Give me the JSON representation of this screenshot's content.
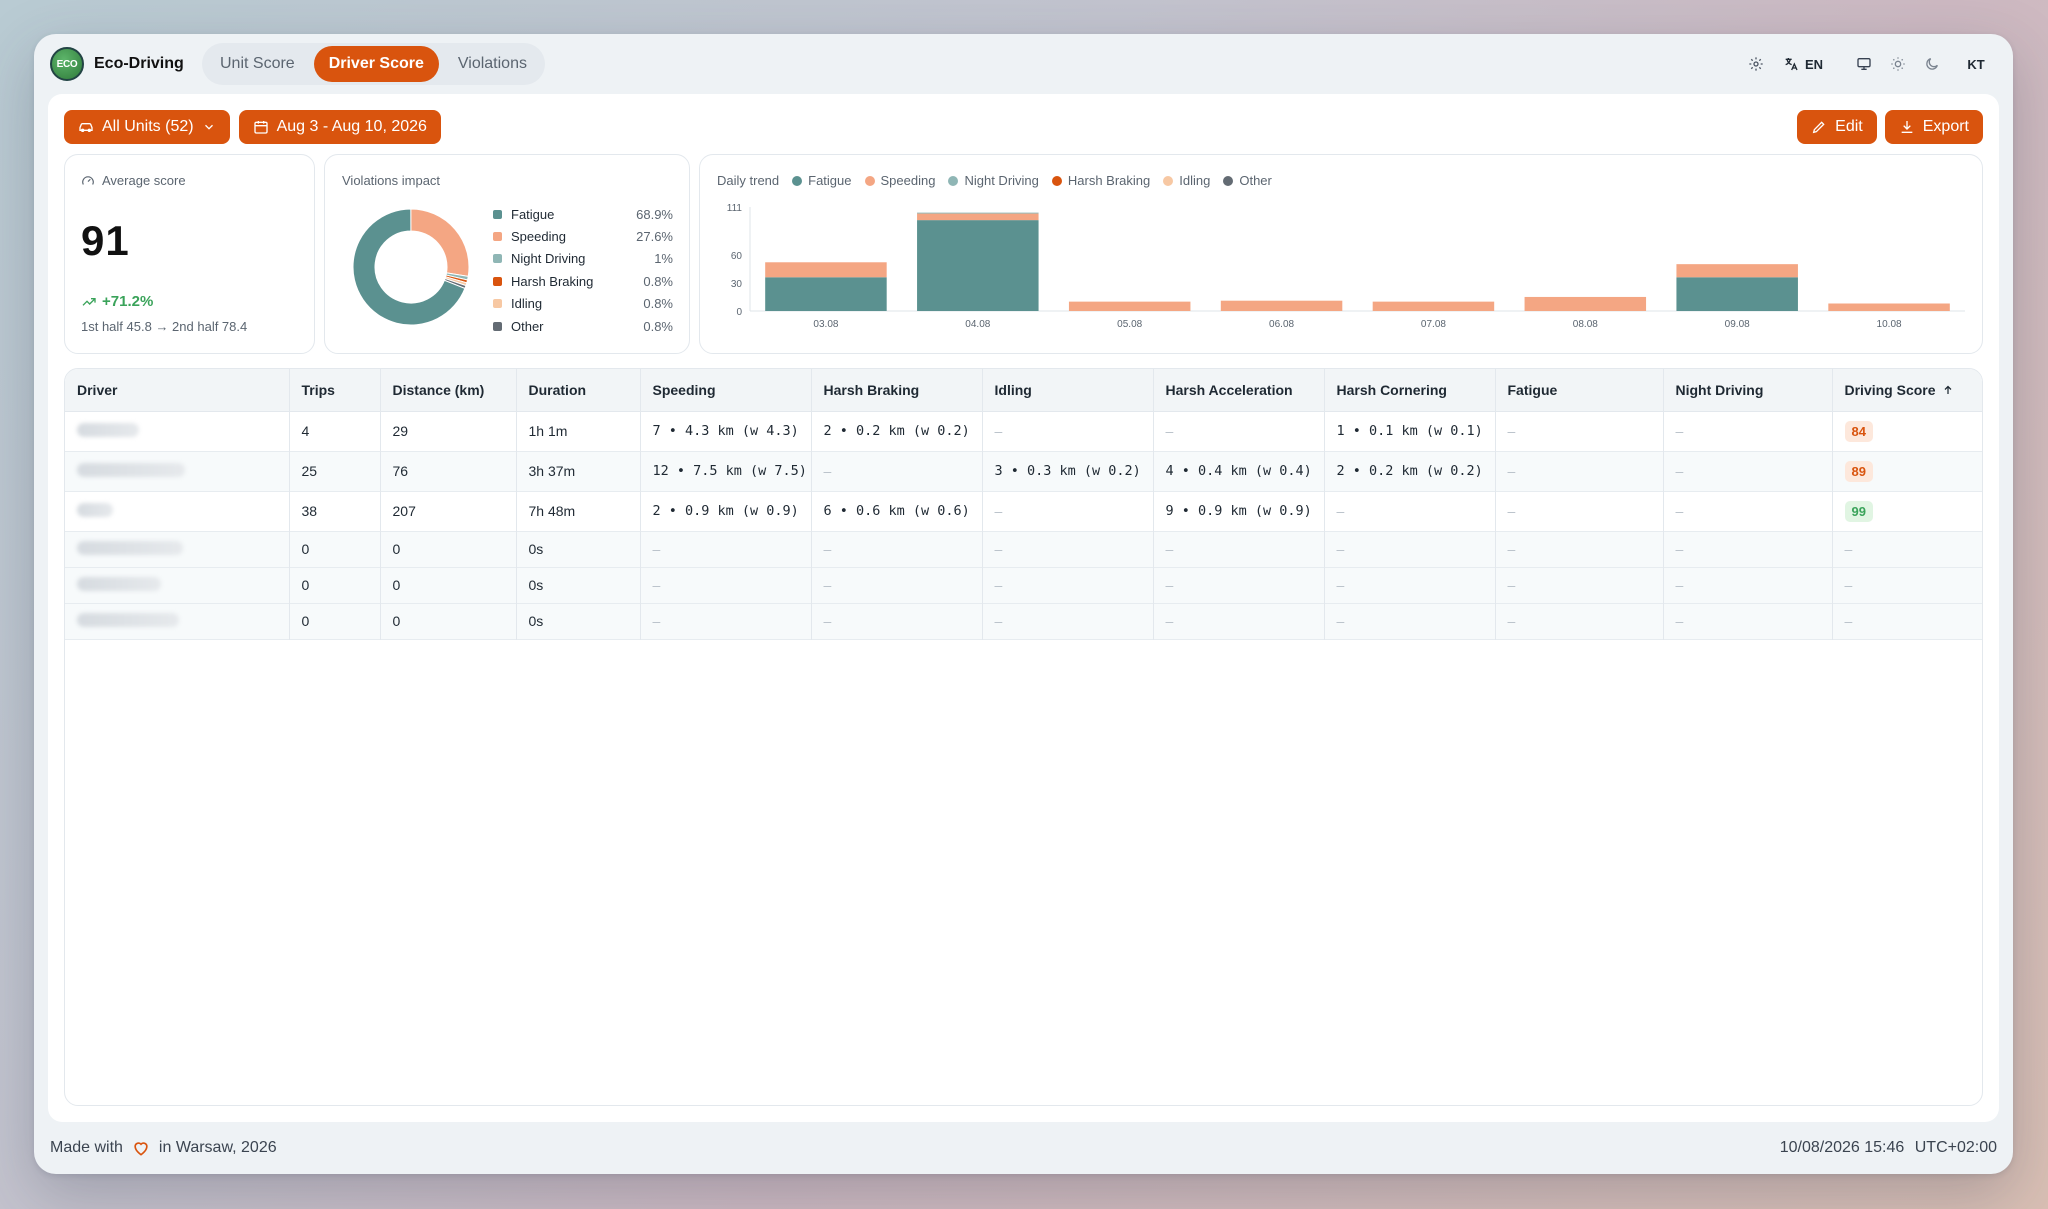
{
  "app": {
    "logo_text": "ECO",
    "name": "Eco-Driving"
  },
  "tabs": [
    {
      "label": "Unit Score",
      "active": false
    },
    {
      "label": "Driver Score",
      "active": true
    },
    {
      "label": "Violations",
      "active": false
    }
  ],
  "topbar": {
    "settings_icon": "gear-icon",
    "lang_icon": "translate-icon",
    "lang": "EN",
    "theme_icons": [
      "monitor-icon",
      "sun-icon",
      "moon-icon"
    ],
    "user_initials": "KT"
  },
  "filters": {
    "units_label": "All Units (52)",
    "date_range": "Aug 3 - Aug 10, 2026"
  },
  "actions": {
    "edit_label": "Edit",
    "export_label": "Export"
  },
  "colors": {
    "accent": "#d9540e",
    "fatigue": "#5b9190",
    "speeding": "#f4a683",
    "night": "#8fb6b5",
    "harsh_braking": "#d9540e",
    "idling": "#f7c8a3",
    "other": "#636b73"
  },
  "average_score": {
    "title": "Average score",
    "value": "91",
    "delta": "+71.2%",
    "halves": "1st half 45.8 → 2nd half 78.4"
  },
  "violations_impact": {
    "title": "Violations impact",
    "items": [
      {
        "name": "Fatigue",
        "value": "68.9%",
        "pct": 68.9,
        "color": "#5b9190"
      },
      {
        "name": "Speeding",
        "value": "27.6%",
        "pct": 27.6,
        "color": "#f4a683"
      },
      {
        "name": "Night Driving",
        "value": "1%",
        "pct": 1.0,
        "color": "#8fb6b5"
      },
      {
        "name": "Harsh Braking",
        "value": "0.8%",
        "pct": 0.8,
        "color": "#d9540e"
      },
      {
        "name": "Idling",
        "value": "0.8%",
        "pct": 0.8,
        "color": "#f7c8a3"
      },
      {
        "name": "Other",
        "value": "0.8%",
        "pct": 0.8,
        "color": "#636b73"
      }
    ]
  },
  "chart_data": {
    "type": "bar",
    "title": "Daily trend",
    "stacked": true,
    "categories": [
      "03.08",
      "04.08",
      "05.08",
      "06.08",
      "07.08",
      "08.08",
      "09.08",
      "10.08"
    ],
    "y_ticks": [
      0,
      30,
      60,
      111
    ],
    "ylim": [
      0,
      111
    ],
    "series": [
      {
        "name": "Fatigue",
        "color": "#5b9190",
        "values": [
          36,
          97,
          0,
          0,
          0,
          0,
          36,
          0
        ]
      },
      {
        "name": "Speeding",
        "color": "#f4a683",
        "values": [
          16,
          7,
          10,
          11,
          10,
          15,
          14,
          8
        ]
      },
      {
        "name": "Night Driving",
        "color": "#8fb6b5",
        "values": [
          0,
          1,
          0,
          0,
          0,
          0,
          0,
          0
        ]
      },
      {
        "name": "Harsh Braking",
        "color": "#d9540e",
        "values": [
          0,
          0,
          0,
          0,
          0,
          0,
          0,
          0
        ]
      },
      {
        "name": "Idling",
        "color": "#f7c8a3",
        "values": [
          0,
          0,
          0,
          0,
          0,
          0,
          0,
          0
        ]
      },
      {
        "name": "Other",
        "color": "#636b73",
        "values": [
          0,
          0,
          0,
          0,
          0,
          0,
          0,
          0
        ]
      }
    ]
  },
  "table": {
    "columns": [
      "Driver",
      "Trips",
      "Distance (km)",
      "Duration",
      "Speeding",
      "Harsh Braking",
      "Idling",
      "Harsh Acceleration",
      "Harsh Cornering",
      "Fatigue",
      "Night Driving",
      "Driving Score"
    ],
    "rows": [
      {
        "trips": "4",
        "distance": "29",
        "duration": "1h 1m",
        "speeding": "7 • 4.3 km (w 4.3)",
        "harsh_braking": "2 • 0.2 km (w 0.2)",
        "idling": "–",
        "harsh_acceleration": "–",
        "harsh_cornering": "1 • 0.1 km (w 0.1)",
        "fatigue": "–",
        "night_driving": "–",
        "score": "84",
        "score_level": "orange"
      },
      {
        "trips": "25",
        "distance": "76",
        "duration": "3h 37m",
        "speeding": "12 • 7.5 km (w 7.5)",
        "harsh_braking": "–",
        "idling": "3 • 0.3 km (w 0.2)",
        "harsh_acceleration": "4 • 0.4 km (w 0.4)",
        "harsh_cornering": "2 • 0.2 km (w 0.2)",
        "fatigue": "–",
        "night_driving": "–",
        "score": "89",
        "score_level": "orange"
      },
      {
        "trips": "38",
        "distance": "207",
        "duration": "7h 48m",
        "speeding": "2 • 0.9 km (w 0.9)",
        "harsh_braking": "6 • 0.6 km (w 0.6)",
        "idling": "–",
        "harsh_acceleration": "9 • 0.9 km (w 0.9)",
        "harsh_cornering": "–",
        "fatigue": "–",
        "night_driving": "–",
        "score": "99",
        "score_level": "green"
      },
      {
        "trips": "0",
        "distance": "0",
        "duration": "0s",
        "speeding": "–",
        "harsh_braking": "–",
        "idling": "–",
        "harsh_acceleration": "–",
        "harsh_cornering": "–",
        "fatigue": "–",
        "night_driving": "–",
        "score": "–"
      },
      {
        "trips": "0",
        "distance": "0",
        "duration": "0s",
        "speeding": "–",
        "harsh_braking": "–",
        "idling": "–",
        "harsh_acceleration": "–",
        "harsh_cornering": "–",
        "fatigue": "–",
        "night_driving": "–",
        "score": "–"
      },
      {
        "trips": "0",
        "distance": "0",
        "duration": "0s",
        "speeding": "–",
        "harsh_braking": "–",
        "idling": "–",
        "harsh_acceleration": "–",
        "harsh_cornering": "–",
        "fatigue": "–",
        "night_driving": "–",
        "score": "–"
      }
    ]
  },
  "footer": {
    "made_with": "Made with",
    "heart_icon": "heart-icon",
    "location": "in Warsaw, 2026",
    "datetime": "10/08/2026 15:46",
    "timezone": "UTC+02:00"
  }
}
